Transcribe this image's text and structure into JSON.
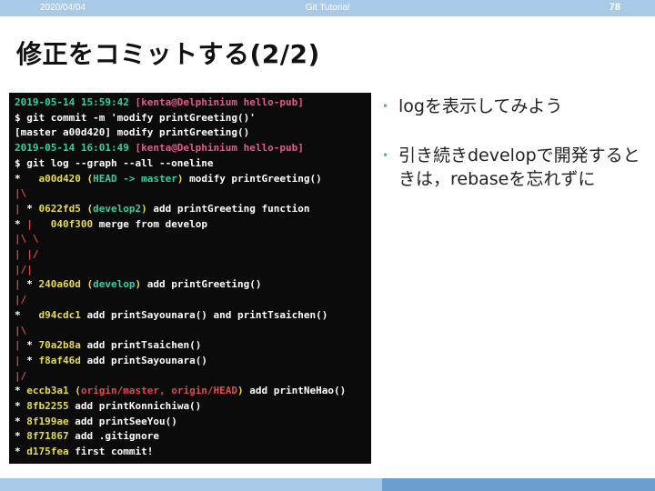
{
  "header": {
    "date": "2020/04/04",
    "center": "Git Tutorial",
    "page_number": "78"
  },
  "title": "修正をコミットする(2/2)",
  "bullets": [
    "logを表示してみよう",
    "引き続きdevelopで開発するときは，rebaseを忘れずに"
  ],
  "terminal": {
    "lines": [
      [
        [
          "2019-05-14 15:59:42 ",
          "g"
        ],
        [
          "[kenta@Delphinium hello-pub]",
          "m"
        ]
      ],
      [
        [
          "$ git commit -m 'modify printGreeting()'",
          ""
        ]
      ],
      [
        [
          "[master a00d420] modify printGreeting()",
          ""
        ]
      ],
      [
        [
          "2019-05-14 16:01:49 ",
          "g"
        ],
        [
          "[kenta@Delphinium hello-pub]",
          "m"
        ]
      ],
      [
        [
          "$ git log --graph --all --oneline",
          ""
        ]
      ],
      [
        [
          "*   ",
          ""
        ],
        [
          "a00d420",
          "y"
        ],
        [
          " (",
          "y"
        ],
        [
          "HEAD -> master",
          "g"
        ],
        [
          ")",
          "y"
        ],
        [
          " modify printGreeting()",
          ""
        ]
      ],
      [
        [
          "|\\",
          "r"
        ]
      ],
      [
        [
          "| ",
          "r"
        ],
        [
          "* ",
          ""
        ],
        [
          "0622fd5",
          "y"
        ],
        [
          " (",
          "y"
        ],
        [
          "develop2",
          "g"
        ],
        [
          ")",
          "y"
        ],
        [
          " add printGreeting function",
          ""
        ]
      ],
      [
        [
          "* ",
          ""
        ],
        [
          "|   ",
          "r"
        ],
        [
          "040f300",
          "y"
        ],
        [
          " merge from develop",
          ""
        ]
      ],
      [
        [
          "|\\ \\",
          "r"
        ]
      ],
      [
        [
          "| |/",
          "r"
        ]
      ],
      [
        [
          "|/|",
          "r"
        ]
      ],
      [
        [
          "| ",
          "r"
        ],
        [
          "* ",
          ""
        ],
        [
          "240a60d",
          "y"
        ],
        [
          " (",
          "y"
        ],
        [
          "develop",
          "g"
        ],
        [
          ")",
          "y"
        ],
        [
          " add printGreeting()",
          ""
        ]
      ],
      [
        [
          "|/",
          "r"
        ]
      ],
      [
        [
          "*   ",
          ""
        ],
        [
          "d94cdc1",
          "y"
        ],
        [
          " add printSayounara() and printTsaichen()",
          ""
        ]
      ],
      [
        [
          "|\\",
          "r"
        ]
      ],
      [
        [
          "| ",
          "r"
        ],
        [
          "* ",
          ""
        ],
        [
          "70a2b8a",
          "y"
        ],
        [
          " add printTsaichen()",
          ""
        ]
      ],
      [
        [
          "| ",
          "r"
        ],
        [
          "* ",
          ""
        ],
        [
          "f8af46d",
          "y"
        ],
        [
          " add printSayounara()",
          ""
        ]
      ],
      [
        [
          "|/",
          "r"
        ]
      ],
      [
        [
          "* ",
          ""
        ],
        [
          "eccb3a1",
          "y"
        ],
        [
          " (",
          "y"
        ],
        [
          "origin/master, origin/HEAD",
          "r"
        ],
        [
          ")",
          "y"
        ],
        [
          " add printNeHao()",
          ""
        ]
      ],
      [
        [
          "* ",
          ""
        ],
        [
          "8fb2255",
          "y"
        ],
        [
          " add printKonnichiwa()",
          ""
        ]
      ],
      [
        [
          "* ",
          ""
        ],
        [
          "8f199ae",
          "y"
        ],
        [
          " add printSeeYou()",
          ""
        ]
      ],
      [
        [
          "* ",
          ""
        ],
        [
          "8f71867",
          "y"
        ],
        [
          " add .gitignore",
          ""
        ]
      ],
      [
        [
          "* ",
          ""
        ],
        [
          "d175fea",
          "y"
        ],
        [
          " first commit!",
          ""
        ]
      ]
    ]
  },
  "colors": {
    "topbar": "#a8c9e8",
    "accent": "#6c9fd0",
    "terminal_bg": "#0b0b0b"
  }
}
